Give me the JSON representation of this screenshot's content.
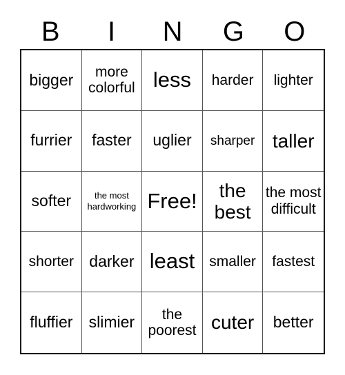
{
  "card": {
    "title": "BINGO",
    "header_letters": [
      "B",
      "I",
      "N",
      "G",
      "O"
    ],
    "rows": 5,
    "columns": 5,
    "colors": {
      "background": "#ffffff",
      "text": "#000000",
      "outer_border": "#1a1a1a",
      "grid_line": "#555555"
    },
    "cells": [
      {
        "text": "bigger",
        "size": "fs-lg",
        "free": false
      },
      {
        "text": "more colorful",
        "size": "fs-md",
        "free": false
      },
      {
        "text": "less",
        "size": "fs-xxl",
        "free": false
      },
      {
        "text": "harder",
        "size": "fs-md",
        "free": false
      },
      {
        "text": "lighter",
        "size": "fs-md",
        "free": false
      },
      {
        "text": "furrier",
        "size": "fs-lg",
        "free": false
      },
      {
        "text": "faster",
        "size": "fs-lg",
        "free": false
      },
      {
        "text": "uglier",
        "size": "fs-lg",
        "free": false
      },
      {
        "text": "sharper",
        "size": "fs-sm",
        "free": false
      },
      {
        "text": "taller",
        "size": "fs-xl",
        "free": false
      },
      {
        "text": "softer",
        "size": "fs-lg",
        "free": false
      },
      {
        "text": "the most hardworking",
        "size": "fs-xs",
        "free": false
      },
      {
        "text": "Free!",
        "size": "fs-xxl",
        "free": true
      },
      {
        "text": "the best",
        "size": "fs-xl",
        "free": false
      },
      {
        "text": "the most difficult",
        "size": "fs-md",
        "free": false
      },
      {
        "text": "shorter",
        "size": "fs-md",
        "free": false
      },
      {
        "text": "darker",
        "size": "fs-lg",
        "free": false
      },
      {
        "text": "least",
        "size": "fs-xxl",
        "free": false
      },
      {
        "text": "smaller",
        "size": "fs-md",
        "free": false
      },
      {
        "text": "fastest",
        "size": "fs-md",
        "free": false
      },
      {
        "text": "fluffier",
        "size": "fs-lg",
        "free": false
      },
      {
        "text": "slimier",
        "size": "fs-lg",
        "free": false
      },
      {
        "text": "the poorest",
        "size": "fs-md",
        "free": false
      },
      {
        "text": "cuter",
        "size": "fs-xl",
        "free": false
      },
      {
        "text": "better",
        "size": "fs-lg",
        "free": false
      }
    ]
  }
}
